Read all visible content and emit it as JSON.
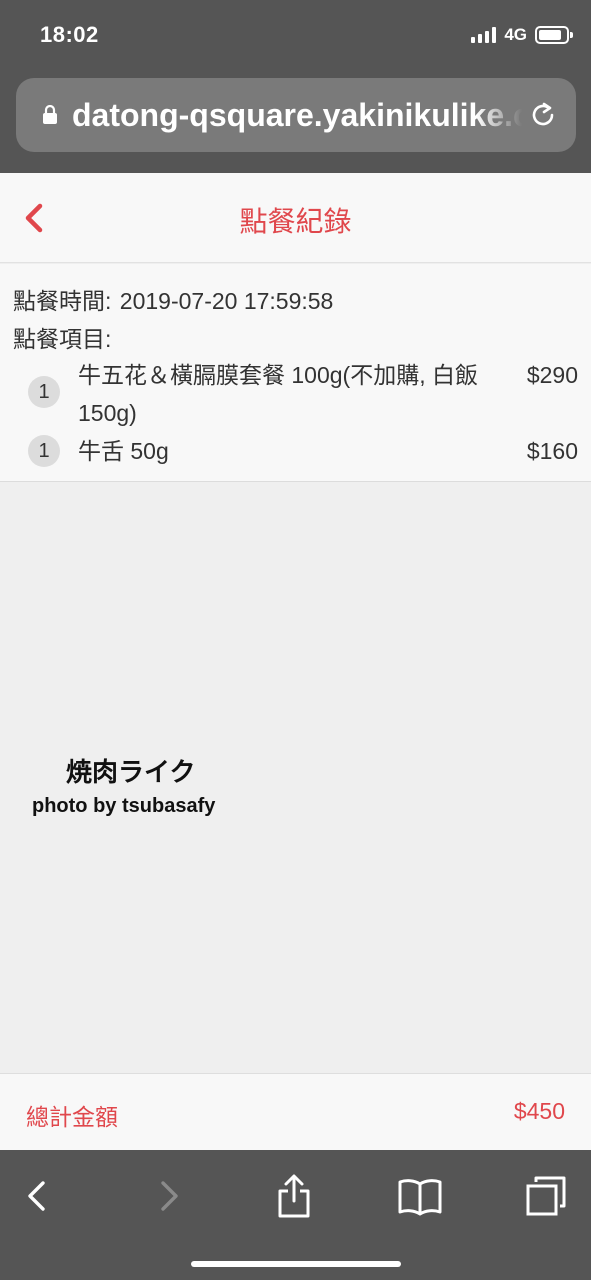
{
  "status_bar": {
    "time": "18:02",
    "network": "4G",
    "signal_bars": 4,
    "battery_level": 0.85
  },
  "browser": {
    "url": "datong-qsquare.yakinikulike.com",
    "icons": {
      "lock": "lock-icon",
      "reload": "reload-icon"
    }
  },
  "header": {
    "title": "點餐紀錄",
    "back_icon": "chevron-left-icon"
  },
  "order": {
    "time_label": "點餐時間:",
    "time_value": "2019-07-20 17:59:58",
    "items_label": "點餐項目:",
    "items": [
      {
        "qty": "1",
        "name": "牛五花＆橫膈膜套餐 100g(不加購, 白飯 150g)",
        "price": "$290"
      },
      {
        "qty": "1",
        "name": "牛舌 50g",
        "price": "$160"
      }
    ]
  },
  "watermark": {
    "title": "焼肉ライク",
    "credit": "photo by tsubasafy"
  },
  "total": {
    "label": "總計金額",
    "value": "$450"
  },
  "toolbar": {
    "buttons": [
      "back-icon",
      "forward-icon",
      "share-icon",
      "bookmarks-icon",
      "tabs-icon"
    ]
  },
  "colors": {
    "accent": "#e0474c",
    "chrome": "#555555",
    "background": "#efefef",
    "panel": "#f8f8f8",
    "text": "#333333"
  }
}
